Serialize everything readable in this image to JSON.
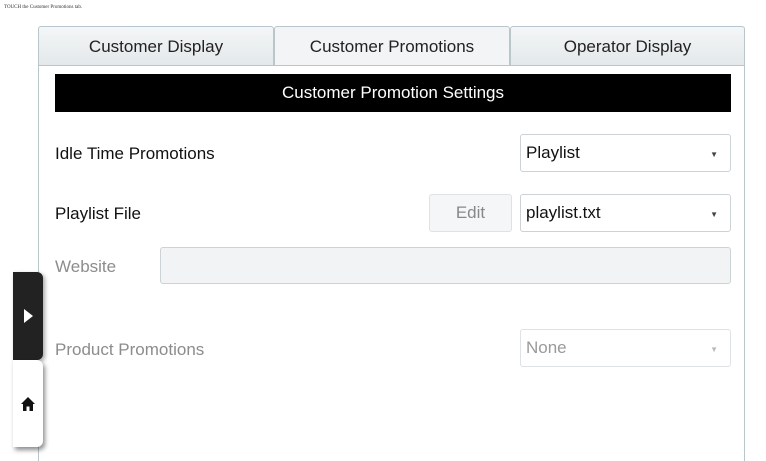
{
  "caption": "TOUCH the Customer Promotions tab.",
  "tabs": [
    {
      "label": "Customer Display",
      "active": false
    },
    {
      "label": "Customer Promotions",
      "active": true
    },
    {
      "label": "Operator Display",
      "active": false
    }
  ],
  "panel": {
    "header": "Customer Promotion Settings",
    "idle_label": "Idle Time Promotions",
    "idle_value": "Playlist",
    "playlist_label": "Playlist File",
    "edit_label": "Edit",
    "playlist_value": "playlist.txt",
    "website_label": "Website",
    "website_value": "",
    "product_label": "Product Promotions",
    "product_value": "None"
  },
  "icons": {
    "dropdown": "chevron-down-icon",
    "side_expand": "play-arrow-icon",
    "home": "home-icon"
  }
}
